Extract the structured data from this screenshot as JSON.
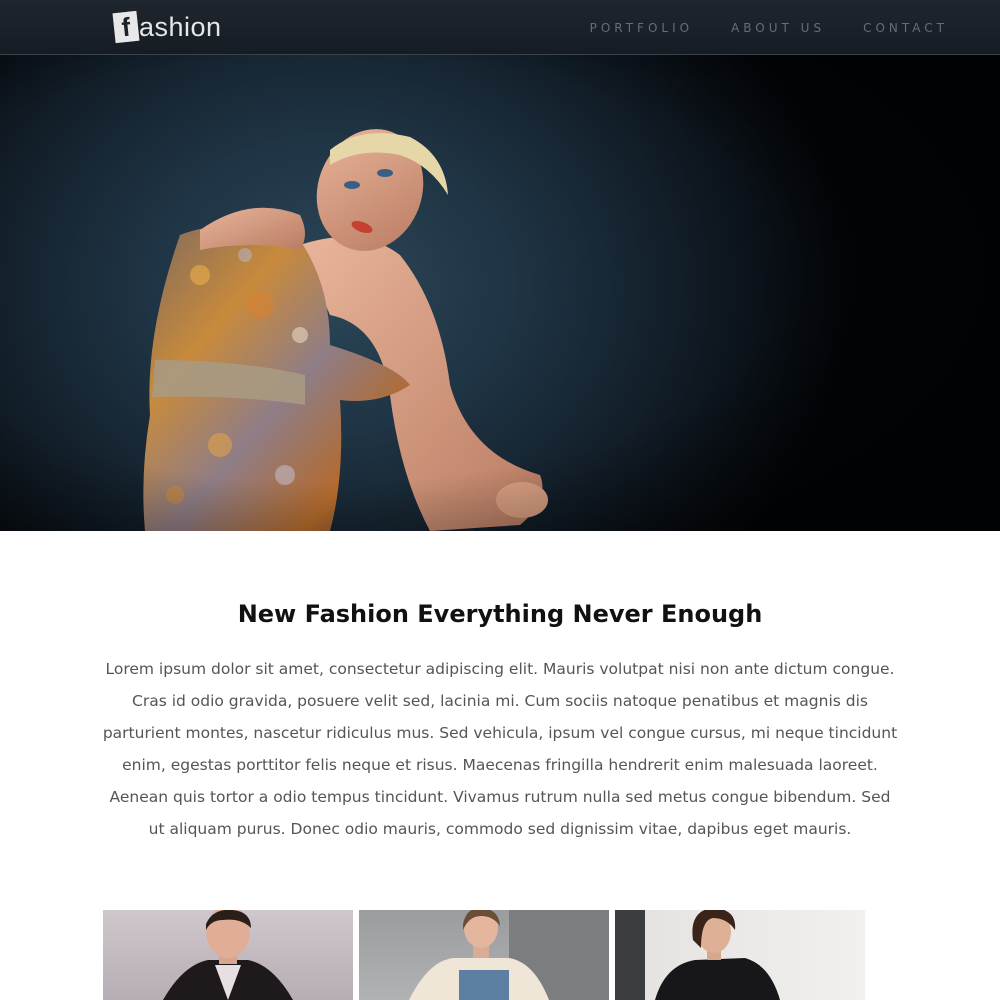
{
  "header": {
    "logo": {
      "badge_letter": "f",
      "text": "ashion"
    },
    "nav": [
      {
        "label": "PORTFOLIO"
      },
      {
        "label": "ABOUT US"
      },
      {
        "label": "CONTACT"
      }
    ]
  },
  "hero": {
    "image": "fashion-model-photo"
  },
  "intro": {
    "title": "New Fashion Everything Never Enough",
    "body": "Lorem ipsum dolor sit amet, consectetur adipiscing elit. Mauris volutpat nisi non ante dictum congue. Cras id odio gravida, posuere velit sed, lacinia mi. Cum sociis natoque penatibus et magnis dis parturient montes, nascetur ridiculus mus. Sed vehicula, ipsum vel congue cursus, mi neque tincidunt enim, egestas porttitor felis neque et risus. Maecenas fringilla hendrerit enim malesuada laoreet. Aenean quis tortor a odio tempus tincidunt. Vivamus rutrum nulla sed metus congue bibendum. Sed ut aliquam purus. Donec odio mauris, commodo sed dignissim vitae, dapibus eget mauris."
  },
  "gallery": [
    {
      "image": "male-model-coat-photo"
    },
    {
      "image": "female-model-fur-vest-photo"
    },
    {
      "image": "female-model-leather-jacket-photo"
    }
  ],
  "colors": {
    "header_bg": "#1b2229",
    "nav_text": "#5f6f7e",
    "title_text": "#111111",
    "body_text": "#555555"
  }
}
